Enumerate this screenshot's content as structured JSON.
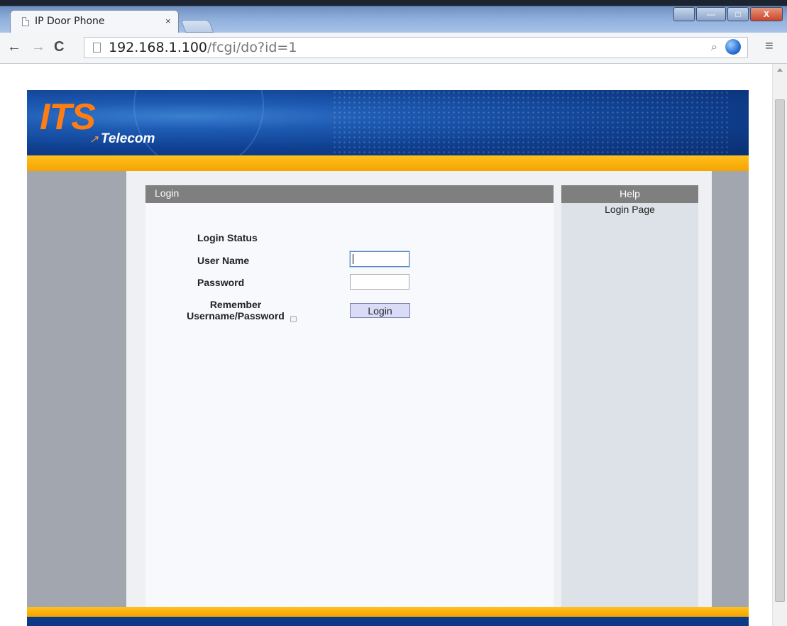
{
  "browser": {
    "tab_title": "IP Door Phone",
    "tab_close": "×",
    "url_host": "192.168.1.100",
    "url_path": "/fcgi/do?id=1",
    "icons": {
      "back": "←",
      "forward": "→",
      "reload": "C",
      "zoom": "🔍",
      "bookmark": "☆",
      "menu": "≡",
      "win_user": "👤",
      "win_min": "—",
      "win_max": "□",
      "win_close": "X"
    }
  },
  "brand": {
    "logo": "ITS",
    "sub": "Telecom",
    "arrow": "↗",
    "orange": "#ff7d12",
    "navy": "#0f3f8f",
    "yellow": "#f5a300"
  },
  "login": {
    "header": "Login",
    "status_label": "Login Status",
    "username_label": "User Name",
    "username_value": "",
    "password_label": "Password",
    "password_value": "",
    "remember_label": "Remember Username/Password",
    "remember_checked": false,
    "button_label": "Login"
  },
  "help": {
    "header": "Help",
    "text": "Login Page"
  }
}
